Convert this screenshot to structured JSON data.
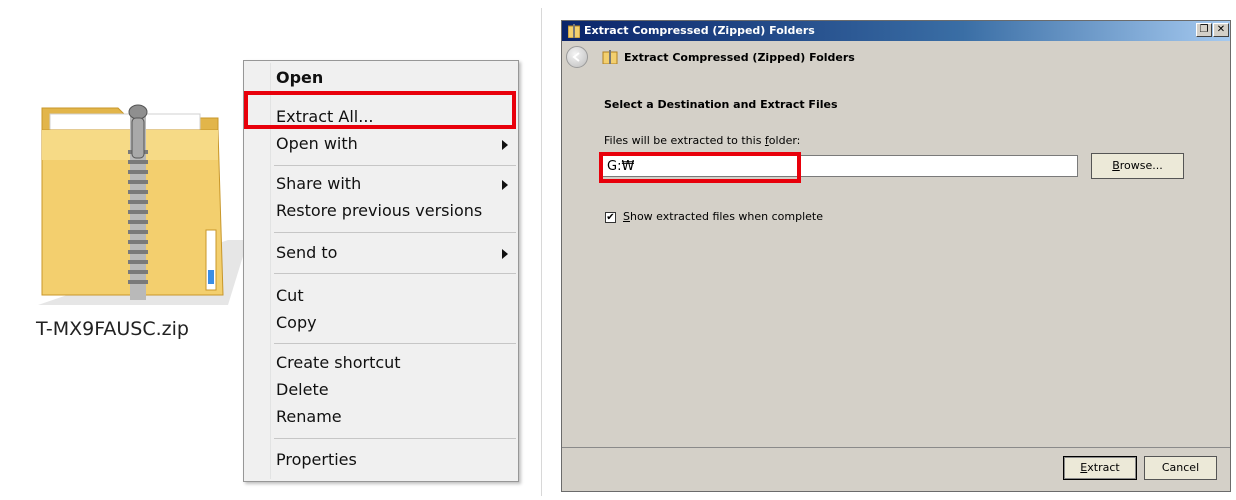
{
  "file": {
    "name": "T-MX9FAUSC.zip",
    "icon": "zipped-folder-icon"
  },
  "context_menu": {
    "items": [
      {
        "label": "Open",
        "bold": true
      },
      {
        "label": "Extract All..."
      },
      {
        "label": "Open with",
        "submenu": true
      },
      {
        "label": "Share with",
        "submenu": true
      },
      {
        "label": "Restore previous versions"
      },
      {
        "label": "Send to",
        "submenu": true
      },
      {
        "label": "Cut"
      },
      {
        "label": "Copy"
      },
      {
        "label": "Create shortcut"
      },
      {
        "label": "Delete"
      },
      {
        "label": "Rename"
      },
      {
        "label": "Properties"
      }
    ]
  },
  "dialog": {
    "window_title": "Extract Compressed (Zipped) Folders",
    "nav_title": "Extract Compressed (Zipped) Folders",
    "heading": "Select a Destination and Extract Files",
    "path_label": "Files will be extracted to this folder:",
    "path_value": "G:₩",
    "browse_label": "Browse...",
    "checkbox_label": "Show extracted files when complete",
    "checkbox_checked": true,
    "extract_label": "Extract",
    "cancel_label": "Cancel"
  },
  "colors": {
    "highlight": "#e8000b",
    "dialog_bg": "#d4d0c8",
    "menu_bg": "#f0f0f0"
  }
}
